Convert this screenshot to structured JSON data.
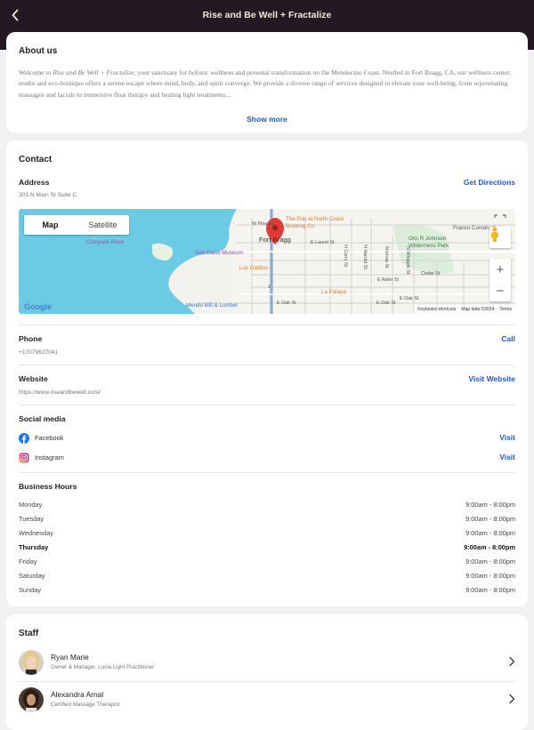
{
  "header": {
    "title": "Rise and Be Well + Fractalize"
  },
  "about": {
    "title": "About us",
    "text_intro": "Welcome to ",
    "text_name": "Rise and Be Well + Fractalize",
    "text_body": ", your sanctuary for holistic wellness and personal transformation on the Mendocino Coast. Nestled in Fort Bragg, CA, our wellness center, studio and eco-boutique offers a serene escape where mind, body, and spirit converge. We provide a diverse range of services designed to elevate your well-being, from rejuvenating massages and facials to immersive float therapy and healing light treatments...",
    "show_more": "Show more"
  },
  "contact": {
    "title": "Contact",
    "address_label": "Address",
    "address_value": "303 N Main St Suite C",
    "directions": "Get Directions",
    "map": {
      "tab_map": "Map",
      "tab_satellite": "Satellite",
      "labels": {
        "compass_rose": "Compass Rose",
        "sea_glass": "Sea Glass Museum",
        "pub": "The Pub at North Coast Brewing Co",
        "fort_bragg": "Fort Bragg",
        "los_gallitos": "Los Gallitos",
        "la_palapa": "La Palapa",
        "mendo_mill": "Mendo Mill & Lumber",
        "otis": "Otis R Johnson Wilderness Park",
        "franco": "Franco Construct",
        "w_pine": "W Pine St",
        "e_laurel": "E Laurel St",
        "e_alder": "E Alder St",
        "e_oak_1": "E Oak St",
        "e_oak_2": "E Oak St",
        "e_oak_3": "E Oak St",
        "cedar": "Cedar St",
        "n_corry": "N Corry St",
        "n_harold": "N Harold St",
        "morrow": "Morrow St",
        "n_whipple": "N Whipple St",
        "route_1": "1"
      },
      "google": "Google",
      "attribution": [
        "Keyboard shortcuts",
        "Map data ©2024",
        "Terms"
      ]
    },
    "phone_label": "Phone",
    "phone_value": "+17079627041",
    "call": "Call",
    "website_label": "Website",
    "website_value": "https://www.riseandbewell.com/",
    "visit_website": "Visit Website",
    "social_label": "Social media",
    "social": [
      {
        "name": "Facebook",
        "action": "Visit",
        "icon": "facebook-icon"
      },
      {
        "name": "Instagram",
        "action": "Visit",
        "icon": "instagram-icon"
      }
    ],
    "hours_label": "Business Hours",
    "hours": [
      {
        "day": "Monday",
        "time": "9:00am - 8:00pm"
      },
      {
        "day": "Tuesday",
        "time": "9:00am - 8:00pm"
      },
      {
        "day": "Wednesday",
        "time": "9:00am - 8:00pm"
      },
      {
        "day": "Thursday",
        "time": "9:00am - 8:00pm"
      },
      {
        "day": "Friday",
        "time": "9:00am - 8:00pm"
      },
      {
        "day": "Saturday",
        "time": "9:00am - 8:00pm"
      },
      {
        "day": "Sunday",
        "time": "9:00am - 8:00pm"
      }
    ]
  },
  "staff": {
    "title": "Staff",
    "members": [
      {
        "name": "Ryan Marie",
        "role": "Owner & Manager, Lucia Light Practitioner"
      },
      {
        "name": "Alexandra Arnal",
        "role": "Certified Massage Therapist"
      }
    ]
  },
  "colors": {
    "header_bg": "#241822",
    "header_text": "#f4e6cf",
    "link": "#2058c8",
    "ocean": "#6ccbe4",
    "map_pin": "#e23b36"
  }
}
